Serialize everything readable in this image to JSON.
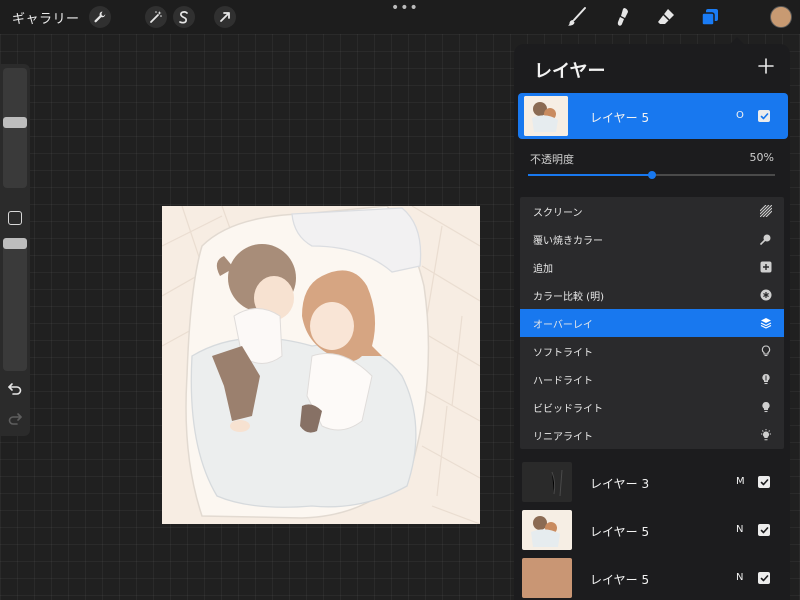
{
  "topbar": {
    "gallery_label": "ギャラリー",
    "left_tools": [
      "wrench-icon",
      "magic-wand-icon",
      "selection-icon",
      "transform-arrow-icon"
    ],
    "more_label": "•••",
    "right_tools": [
      "brush-icon",
      "smudge-icon",
      "eraser-icon",
      "layers-icon"
    ],
    "active_tool": "layers-icon",
    "current_color": "#c89a72"
  },
  "sidebar": {
    "brush_size_level": 0.55,
    "opacity_level": 0.3
  },
  "layers_panel": {
    "title": "レイヤー",
    "add_label": "+",
    "active_layer": {
      "name": "レイヤー 5",
      "mode": "O",
      "visible": true
    },
    "opacity_label": "不透明度",
    "opacity_value": "50%",
    "opacity_fraction": 0.5,
    "blend_modes": [
      {
        "label": "スクリーン",
        "icon": "hatch-icon",
        "selected": false
      },
      {
        "label": "覆い焼きカラー",
        "icon": "magnifier-icon",
        "selected": false
      },
      {
        "label": "追加",
        "icon": "plus-square-icon",
        "selected": false
      },
      {
        "label": "カラー比較 (明)",
        "icon": "asterisk-circle-icon",
        "selected": false
      },
      {
        "label": "オーバーレイ",
        "icon": "layers-stack-icon",
        "selected": true
      },
      {
        "label": "ソフトライト",
        "icon": "bulb-outline-icon",
        "selected": false
      },
      {
        "label": "ハードライト",
        "icon": "bulb-half-icon",
        "selected": false
      },
      {
        "label": "ビビッドライト",
        "icon": "bulb-filled-icon",
        "selected": false
      },
      {
        "label": "リニアライト",
        "icon": "bulb-rays-icon",
        "selected": false
      }
    ],
    "layers": [
      {
        "name": "レイヤー 3",
        "mode": "M",
        "visible": true,
        "thumb": "dark"
      },
      {
        "name": "レイヤー 5",
        "mode": "N",
        "visible": true,
        "thumb": "art"
      },
      {
        "name": "レイヤー 5",
        "mode": "N",
        "visible": true,
        "thumb": "tan"
      }
    ]
  }
}
